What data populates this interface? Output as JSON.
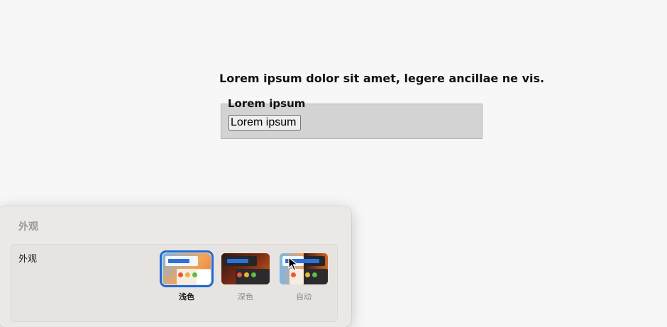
{
  "page": {
    "heading": "Lorem ipsum dolor sit amet, legere ancillae ne vis.",
    "legend": "Lorem ipsum",
    "button_label": "Lorem ipsum"
  },
  "panel": {
    "title": "外观",
    "row_label": "外观",
    "options": [
      {
        "label": "浅色",
        "selected": true
      },
      {
        "label": "深色",
        "selected": false
      },
      {
        "label": "自动",
        "selected": false
      }
    ]
  },
  "colors": {
    "accent": "#1f6ad6",
    "fieldset_bg": "#d3d3d3",
    "page_bg": "#f8f7f7",
    "panel_bg": "#ebe8e6"
  }
}
